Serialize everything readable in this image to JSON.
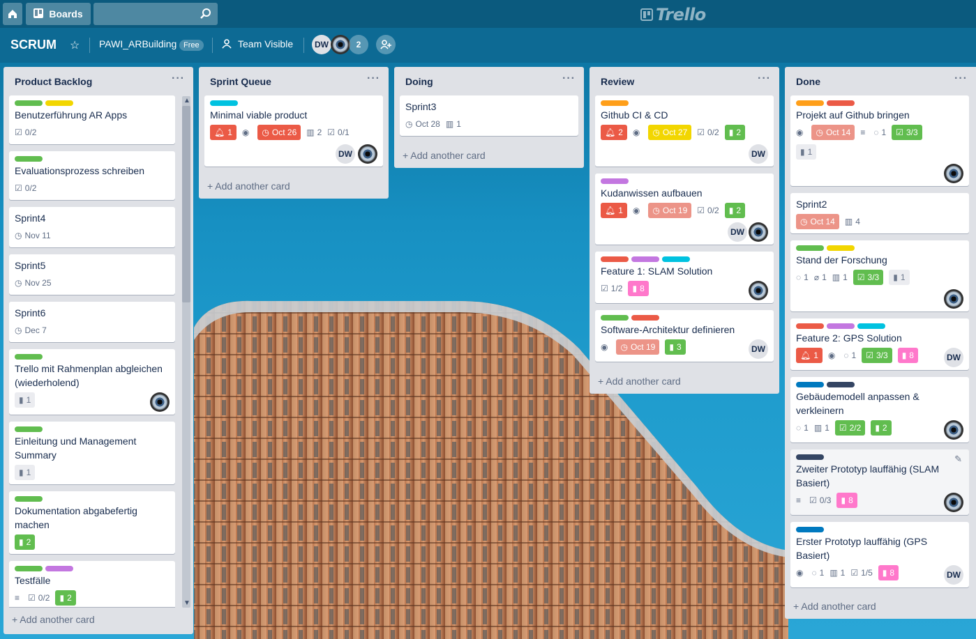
{
  "header": {
    "boards_label": "Boards",
    "search_value": "",
    "logo_text": "Trello"
  },
  "board": {
    "title": "SCRUM",
    "team": "PAWI_ARBuilding",
    "plan_badge": "Free",
    "visibility": "Team Visible",
    "member_initials": "DW",
    "extra_members": "2"
  },
  "colors": {
    "green": "#61bd4f",
    "yellow": "#f2d600",
    "orange": "#ff9f1a",
    "red": "#eb5a46",
    "purple": "#c377e0",
    "sky": "#00c2e0",
    "blue": "#0079bf",
    "navy": "#344563"
  },
  "lists": [
    {
      "title": "Product Backlog",
      "add_label": "+ Add another card",
      "cards": [
        {
          "title": "Benutzerführung AR Apps",
          "checklist": "0/2"
        },
        {
          "title": "Evaluationsprozess schreiben",
          "checklist": "0/2"
        },
        {
          "title": "Sprint4",
          "due": "Nov 11"
        },
        {
          "title": "Sprint5",
          "due": "Nov 25"
        },
        {
          "title": "Sprint6",
          "due": "Dec 7"
        },
        {
          "title": "Trello mit Rahmenplan abgleichen (wiederholend)",
          "ext": "1"
        },
        {
          "title": "Einleitung und Management Summary",
          "ext": "1"
        },
        {
          "title": "Dokumentation abgabefertig machen",
          "ext": "2"
        },
        {
          "title": "Testfälle",
          "checklist": "0/2",
          "ext": "2"
        }
      ]
    },
    {
      "title": "Sprint Queue",
      "add_label": "+ Add another card",
      "cards": [
        {
          "title": "Minimal viable product",
          "notif": "1",
          "due": "Oct 26",
          "boards": "2",
          "checklist": "0/1",
          "avatar": "DW"
        }
      ]
    },
    {
      "title": "Doing",
      "add_label": "+ Add another card",
      "cards": [
        {
          "title": "Sprint3",
          "due": "Oct 28",
          "boards": "1"
        }
      ]
    },
    {
      "title": "Review",
      "add_label": "+ Add another card",
      "cards": [
        {
          "title": "Github CI & CD",
          "notif": "2",
          "due": "Oct 27",
          "checklist": "0/2",
          "ext": "2",
          "avatar": "DW"
        },
        {
          "title": "Kudanwissen aufbauen",
          "notif": "1",
          "due": "Oct 19",
          "checklist": "0/2",
          "ext": "2",
          "avatar": "DW"
        },
        {
          "title": "Feature 1: SLAM Solution",
          "checklist": "1/2",
          "ext": "8"
        },
        {
          "title": "Software-Architektur definieren",
          "due": "Oct 19",
          "ext": "3",
          "avatar": "DW"
        }
      ]
    },
    {
      "title": "Done",
      "add_label": "+ Add another card",
      "cards": [
        {
          "title": "Projekt auf Github bringen",
          "due": "Oct 14",
          "comments": "1",
          "checklist": "3/3",
          "ext": "1"
        },
        {
          "title": "Sprint2",
          "due": "Oct 14",
          "boards": "4"
        },
        {
          "title": "Stand der Forschung",
          "comments": "1",
          "attach": "1",
          "boards": "1",
          "checklist": "3/3",
          "ext": "1"
        },
        {
          "title": "Feature 2: GPS Solution",
          "notif": "1",
          "comments": "1",
          "checklist": "3/3",
          "ext": "8",
          "avatar": "DW"
        },
        {
          "title": "Gebäudemodell anpassen & verkleinern",
          "comments": "1",
          "boards": "1",
          "checklist": "2/2",
          "ext": "2"
        },
        {
          "title": "Zweiter Prototyp lauffähig (SLAM Basiert)",
          "checklist": "0/3",
          "ext": "8"
        },
        {
          "title": "Erster Prototyp lauffähig (GPS Basiert)",
          "comments": "1",
          "boards": "1",
          "checklist": "1/5",
          "ext": "8",
          "avatar": "DW"
        }
      ]
    }
  ]
}
